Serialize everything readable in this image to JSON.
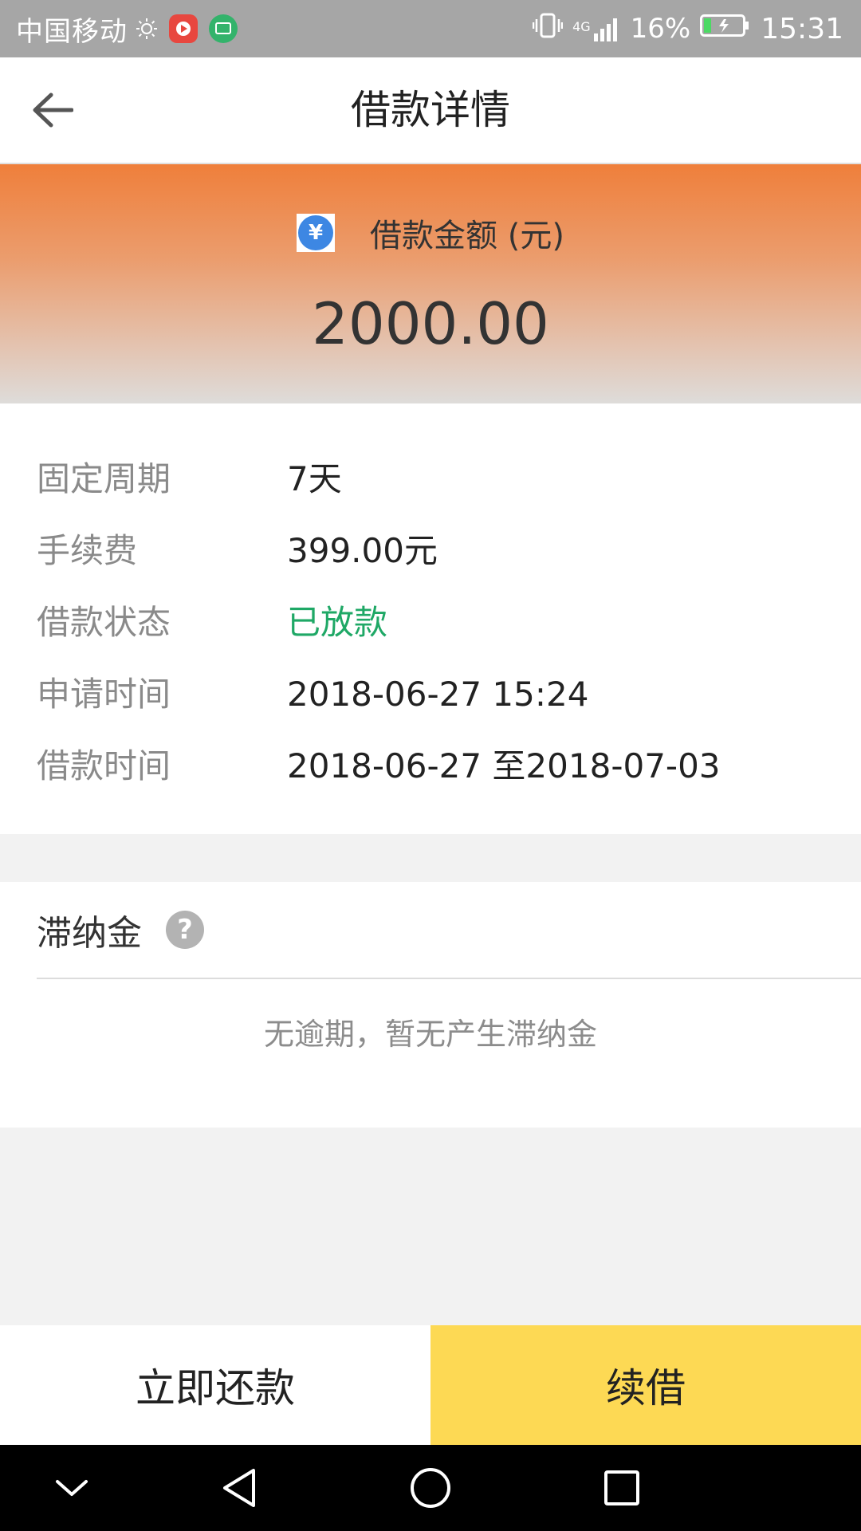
{
  "status_bar": {
    "carrier": "中国移动",
    "network": "4G",
    "battery_percent": "16%",
    "time": "15:31"
  },
  "header": {
    "title": "借款详情"
  },
  "hero": {
    "label": "借款金额 (元)",
    "amount": "2000.00",
    "currency_symbol": "¥"
  },
  "details": [
    {
      "label": "固定周期",
      "value": "7天"
    },
    {
      "label": "手续费",
      "value": "399.00元"
    },
    {
      "label": "借款状态",
      "value": "已放款"
    },
    {
      "label": "申请时间",
      "value": "2018-06-27 15:24"
    },
    {
      "label": "借款时间",
      "value": "2018-06-27 至2018-07-03"
    }
  ],
  "late_fee": {
    "title": "滞纳金",
    "help_symbol": "?",
    "message": "无逾期，暂无产生滞纳金"
  },
  "actions": {
    "repay_label": "立即还款",
    "renew_label": "续借"
  },
  "colors": {
    "hero_top": "#ef7f3b",
    "status_green": "#1fa866",
    "renew_yellow": "#fdd954",
    "yuan_blue": "#3d87e3"
  },
  "icons": {
    "back": "arrow-left-icon",
    "yuan": "yuan-icon",
    "help": "help-icon",
    "nav_down": "chevron-down-icon",
    "nav_back": "triangle-back-icon",
    "nav_home": "circle-home-icon",
    "nav_recents": "square-recents-icon"
  }
}
